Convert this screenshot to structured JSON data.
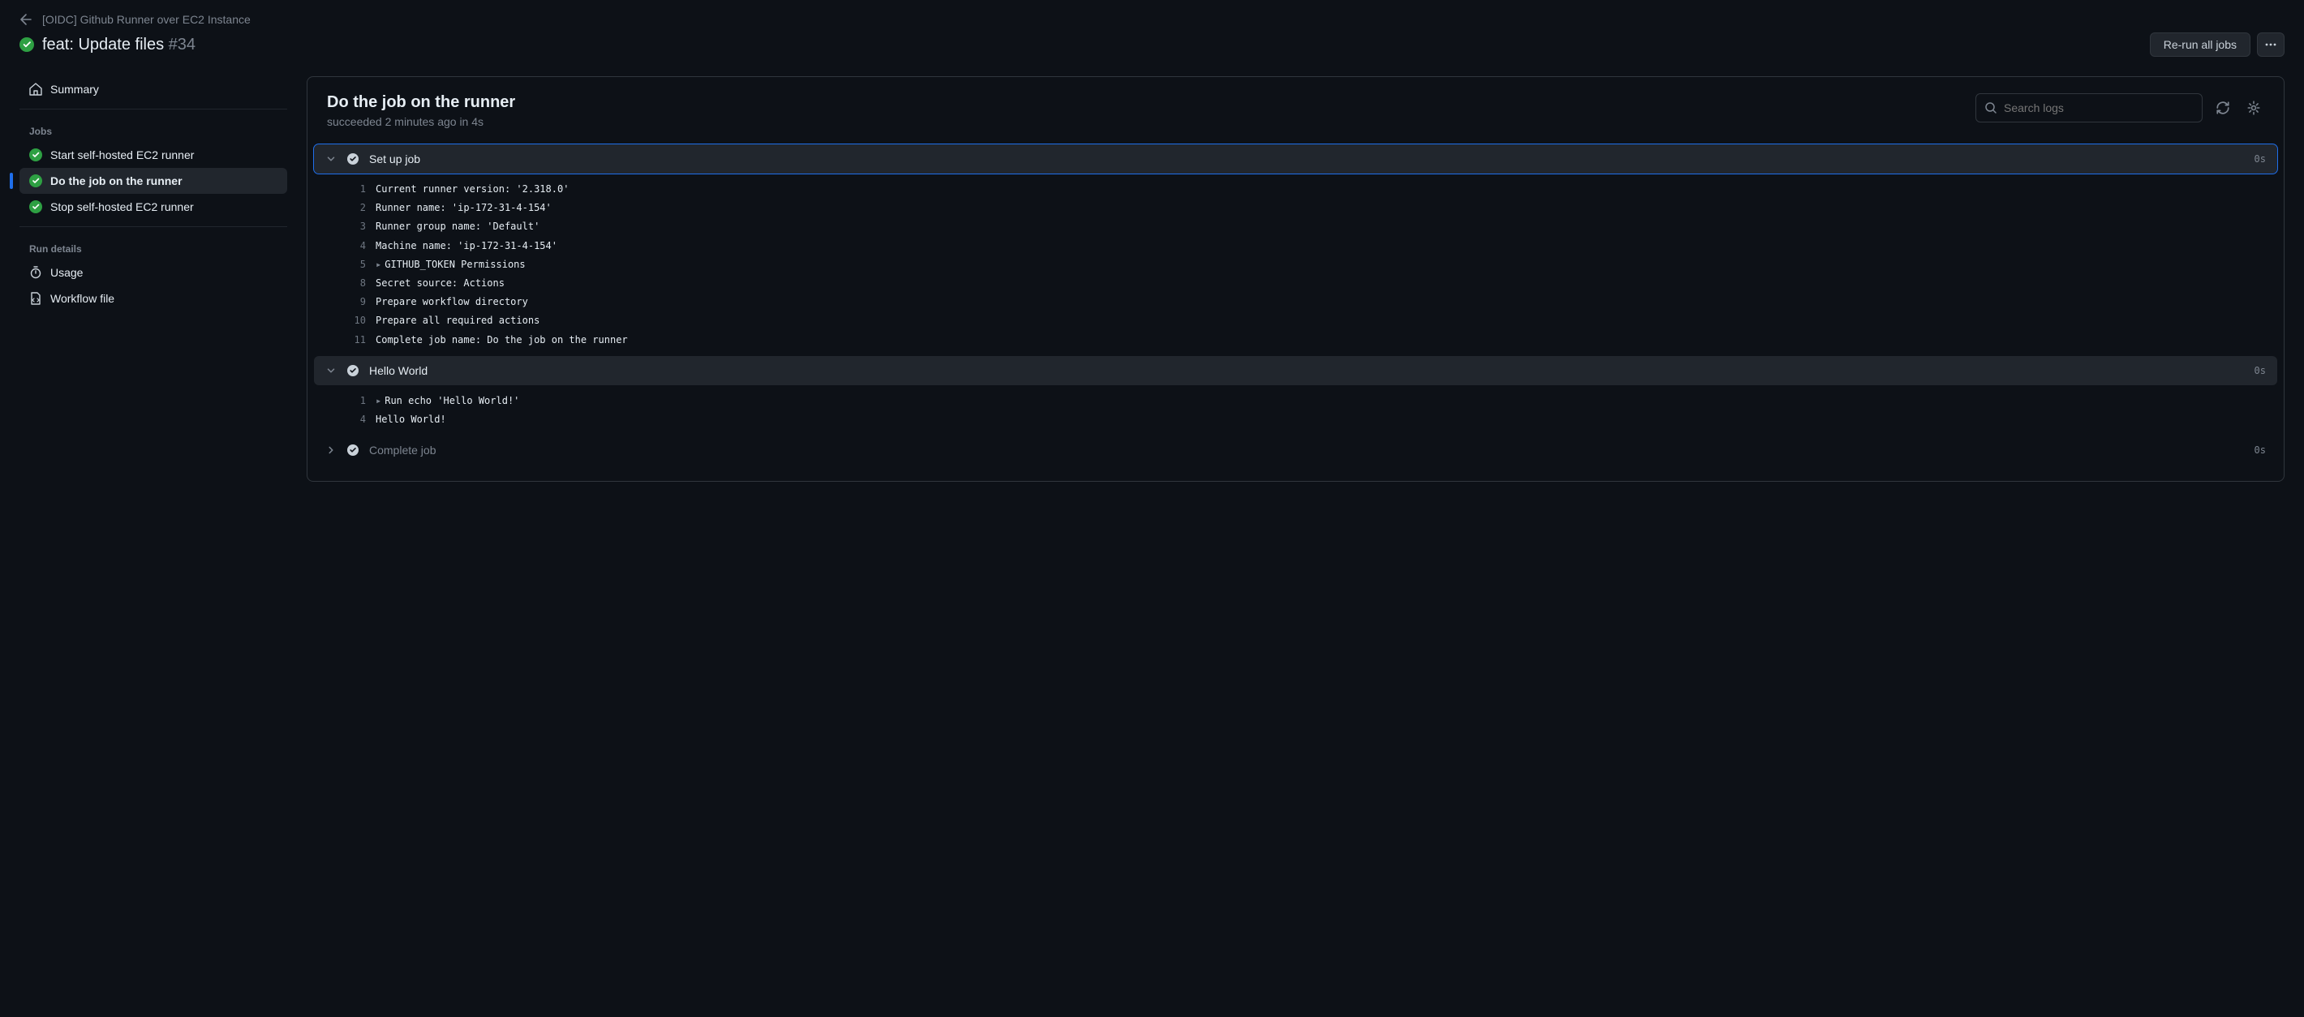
{
  "breadcrumb": {
    "workflow_name": "[OIDC] Github Runner over EC2 Instance"
  },
  "run": {
    "title": "feat: Update files",
    "number": "#34",
    "status": "success"
  },
  "actions": {
    "rerun_label": "Re-run all jobs"
  },
  "sidebar": {
    "summary_label": "Summary",
    "jobs_label": "Jobs",
    "run_details_label": "Run details",
    "usage_label": "Usage",
    "workflow_file_label": "Workflow file",
    "jobs": [
      {
        "name": "Start self-hosted EC2 runner",
        "status": "success",
        "active": false
      },
      {
        "name": "Do the job on the runner",
        "status": "success",
        "active": true
      },
      {
        "name": "Stop self-hosted EC2 runner",
        "status": "success",
        "active": false
      }
    ]
  },
  "job_view": {
    "title": "Do the job on the runner",
    "status_text": "succeeded",
    "timestamp": "2 minutes ago",
    "duration": "4s",
    "meta": "succeeded 2 minutes ago in 4s",
    "search_placeholder": "Search logs"
  },
  "steps": [
    {
      "name": "Set up job",
      "status": "success",
      "duration": "0s",
      "expanded": true,
      "focused": true,
      "lines": [
        {
          "n": "1",
          "text": "Current runner version: '2.318.0'",
          "expandable": false
        },
        {
          "n": "2",
          "text": "Runner name: 'ip-172-31-4-154'",
          "expandable": false
        },
        {
          "n": "3",
          "text": "Runner group name: 'Default'",
          "expandable": false
        },
        {
          "n": "4",
          "text": "Machine name: 'ip-172-31-4-154'",
          "expandable": false
        },
        {
          "n": "5",
          "text": "GITHUB_TOKEN Permissions",
          "expandable": true
        },
        {
          "n": "8",
          "text": "Secret source: Actions",
          "expandable": false
        },
        {
          "n": "9",
          "text": "Prepare workflow directory",
          "expandable": false
        },
        {
          "n": "10",
          "text": "Prepare all required actions",
          "expandable": false
        },
        {
          "n": "11",
          "text": "Complete job name: Do the job on the runner",
          "expandable": false
        }
      ]
    },
    {
      "name": "Hello World",
      "status": "success",
      "duration": "0s",
      "expanded": true,
      "focused": false,
      "lines": [
        {
          "n": "1",
          "text": "Run echo 'Hello World!'",
          "expandable": true
        },
        {
          "n": "4",
          "text": "Hello World!",
          "expandable": false
        }
      ]
    },
    {
      "name": "Complete job",
      "status": "success",
      "duration": "0s",
      "expanded": false,
      "focused": false,
      "lines": []
    }
  ]
}
